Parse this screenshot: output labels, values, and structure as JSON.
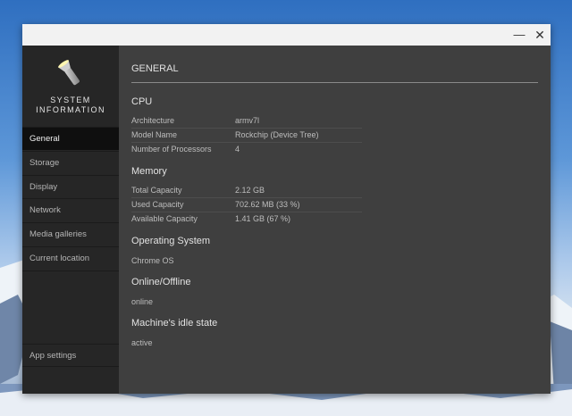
{
  "window": {
    "minimize_icon": "minimize-icon",
    "close_icon": "close-icon",
    "minimize_glyph": "—",
    "close_glyph": "✕"
  },
  "sidebar": {
    "logo_icon": "flashlight-icon",
    "logo_line1": "SYSTEM",
    "logo_line2": "INFORMATION",
    "items": [
      {
        "label": "General",
        "active": true
      },
      {
        "label": "Storage",
        "active": false
      },
      {
        "label": "Display",
        "active": false
      },
      {
        "label": "Network",
        "active": false
      },
      {
        "label": "Media galleries",
        "active": false
      },
      {
        "label": "Current location",
        "active": false
      }
    ],
    "settings_label": "App settings"
  },
  "main": {
    "title": "GENERAL",
    "cpu": {
      "heading": "CPU",
      "rows": [
        {
          "key": "Architecture",
          "value": "armv7l"
        },
        {
          "key": "Model Name",
          "value": "Rockchip (Device Tree)"
        },
        {
          "key": "Number of Processors",
          "value": "4"
        }
      ]
    },
    "memory": {
      "heading": "Memory",
      "rows": [
        {
          "key": "Total Capacity",
          "value": "2.12 GB"
        },
        {
          "key": "Used Capacity",
          "value": "702.62 MB (33 %)"
        },
        {
          "key": "Available Capacity",
          "value": "1.41 GB (67 %)"
        }
      ]
    },
    "os": {
      "heading": "Operating System",
      "value": "Chrome OS"
    },
    "online": {
      "heading": "Online/Offline",
      "value": "online"
    },
    "idle": {
      "heading": "Machine's idle state",
      "value": "active"
    }
  },
  "colors": {
    "window_bg": "#3f3f3f",
    "sidebar_bg": "#262626",
    "active_nav": "#0f0f0f",
    "titlebar": "#f2f2f2"
  }
}
